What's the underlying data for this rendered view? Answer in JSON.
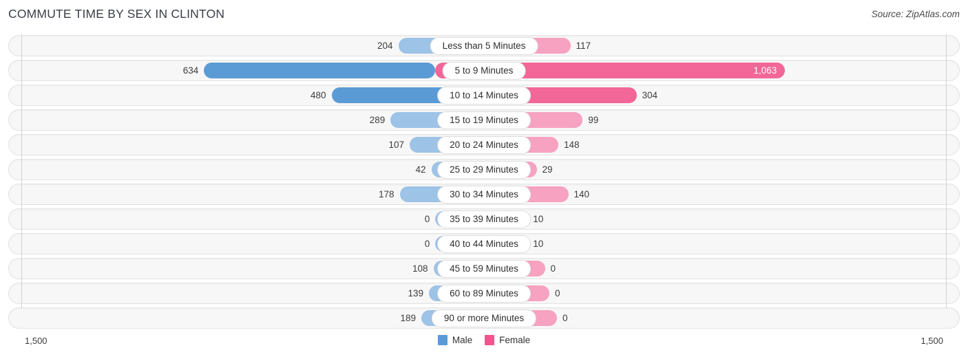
{
  "header": {
    "title": "COMMUTE TIME BY SEX IN CLINTON",
    "source": "Source: ZipAtlas.com"
  },
  "legend": {
    "male_label": "Male",
    "female_label": "Female",
    "male_color": "#5b9bd5",
    "female_color": "#f0568d"
  },
  "axis": {
    "left_tick": "1,500",
    "right_tick": "1,500"
  },
  "colors": {
    "male_light": "#9dc3e6",
    "male_dark": "#5b9bd5",
    "female_light": "#f6a2c0",
    "female_dark": "#f26698",
    "track": "#f7f7f7",
    "title": "#3a3e47"
  },
  "chart_data": {
    "type": "bar",
    "subtype": "diverging-bidirectional",
    "title": "COMMUTE TIME BY SEX IN CLINTON",
    "xlabel": "",
    "ylabel": "",
    "xlim": [
      1500,
      1500
    ],
    "axis_max": 1500,
    "grid": false,
    "legend_position": "bottom-center",
    "categories": [
      "Less than 5 Minutes",
      "5 to 9 Minutes",
      "10 to 14 Minutes",
      "15 to 19 Minutes",
      "20 to 24 Minutes",
      "25 to 29 Minutes",
      "30 to 34 Minutes",
      "35 to 39 Minutes",
      "40 to 44 Minutes",
      "45 to 59 Minutes",
      "60 to 89 Minutes",
      "90 or more Minutes"
    ],
    "series": [
      {
        "name": "Male",
        "direction": "left",
        "values": [
          204,
          634,
          480,
          289,
          107,
          42,
          178,
          0,
          0,
          108,
          139,
          189
        ],
        "labels": [
          "204",
          "634",
          "480",
          "289",
          "107",
          "42",
          "178",
          "0",
          "0",
          "108",
          "139",
          "189"
        ]
      },
      {
        "name": "Female",
        "direction": "right",
        "values": [
          117,
          1063,
          304,
          99,
          148,
          29,
          140,
          10,
          10,
          0,
          0,
          0
        ],
        "labels": [
          "117",
          "1,063",
          "304",
          "99",
          "148",
          "29",
          "140",
          "10",
          "10",
          "0",
          "0",
          "0"
        ]
      }
    ]
  },
  "rows": [
    {
      "label": "Less than 5 Minutes",
      "male": "204",
      "female": "117",
      "male_w": 140,
      "female_w": 110,
      "male_hi": false,
      "female_hi": false,
      "female_inside": false
    },
    {
      "label": "5 to 9 Minutes",
      "male": "634",
      "female": "1,063",
      "male_w": 336,
      "female_w": 508,
      "male_hi": true,
      "female_hi": true,
      "female_inside": true
    },
    {
      "label": "10 to 14 Minutes",
      "male": "480",
      "female": "304",
      "male_w": 260,
      "female_w": 183,
      "male_hi": true,
      "female_hi": true,
      "female_inside": false
    },
    {
      "label": "15 to 19 Minutes",
      "male": "289",
      "female": "99",
      "male_w": 175,
      "female_w": 104,
      "male_hi": false,
      "female_hi": false,
      "female_inside": false
    },
    {
      "label": "20 to 24 Minutes",
      "male": "107",
      "female": "148",
      "male_w": 96,
      "female_w": 120,
      "male_hi": false,
      "female_hi": false,
      "female_inside": false
    },
    {
      "label": "25 to 29 Minutes",
      "male": "42",
      "female": "29",
      "male_w": 78,
      "female_w": 75,
      "male_hi": false,
      "female_hi": false,
      "female_inside": false
    },
    {
      "label": "30 to 34 Minutes",
      "male": "178",
      "female": "140",
      "male_w": 128,
      "female_w": 117,
      "male_hi": false,
      "female_hi": false,
      "female_inside": false
    },
    {
      "label": "35 to 39 Minutes",
      "male": "0",
      "female": "10",
      "male_w": 65,
      "female_w": 69,
      "male_hi": false,
      "female_hi": false,
      "female_inside": false
    },
    {
      "label": "40 to 44 Minutes",
      "male": "0",
      "female": "10",
      "male_w": 65,
      "female_w": 69,
      "male_hi": false,
      "female_hi": false,
      "female_inside": false
    },
    {
      "label": "45 to 59 Minutes",
      "male": "108",
      "female": "0",
      "male_w": 97,
      "female_w": 65,
      "male_hi": false,
      "female_hi": false,
      "female_inside": false
    },
    {
      "label": "60 to 89 Minutes",
      "male": "139",
      "female": "0",
      "male_w": 110,
      "female_w": 65,
      "male_hi": false,
      "female_hi": false,
      "female_inside": false
    },
    {
      "label": "90 or more Minutes",
      "male": "189",
      "female": "0",
      "male_w": 132,
      "female_w": 65,
      "male_hi": false,
      "female_hi": false,
      "female_inside": false
    }
  ]
}
